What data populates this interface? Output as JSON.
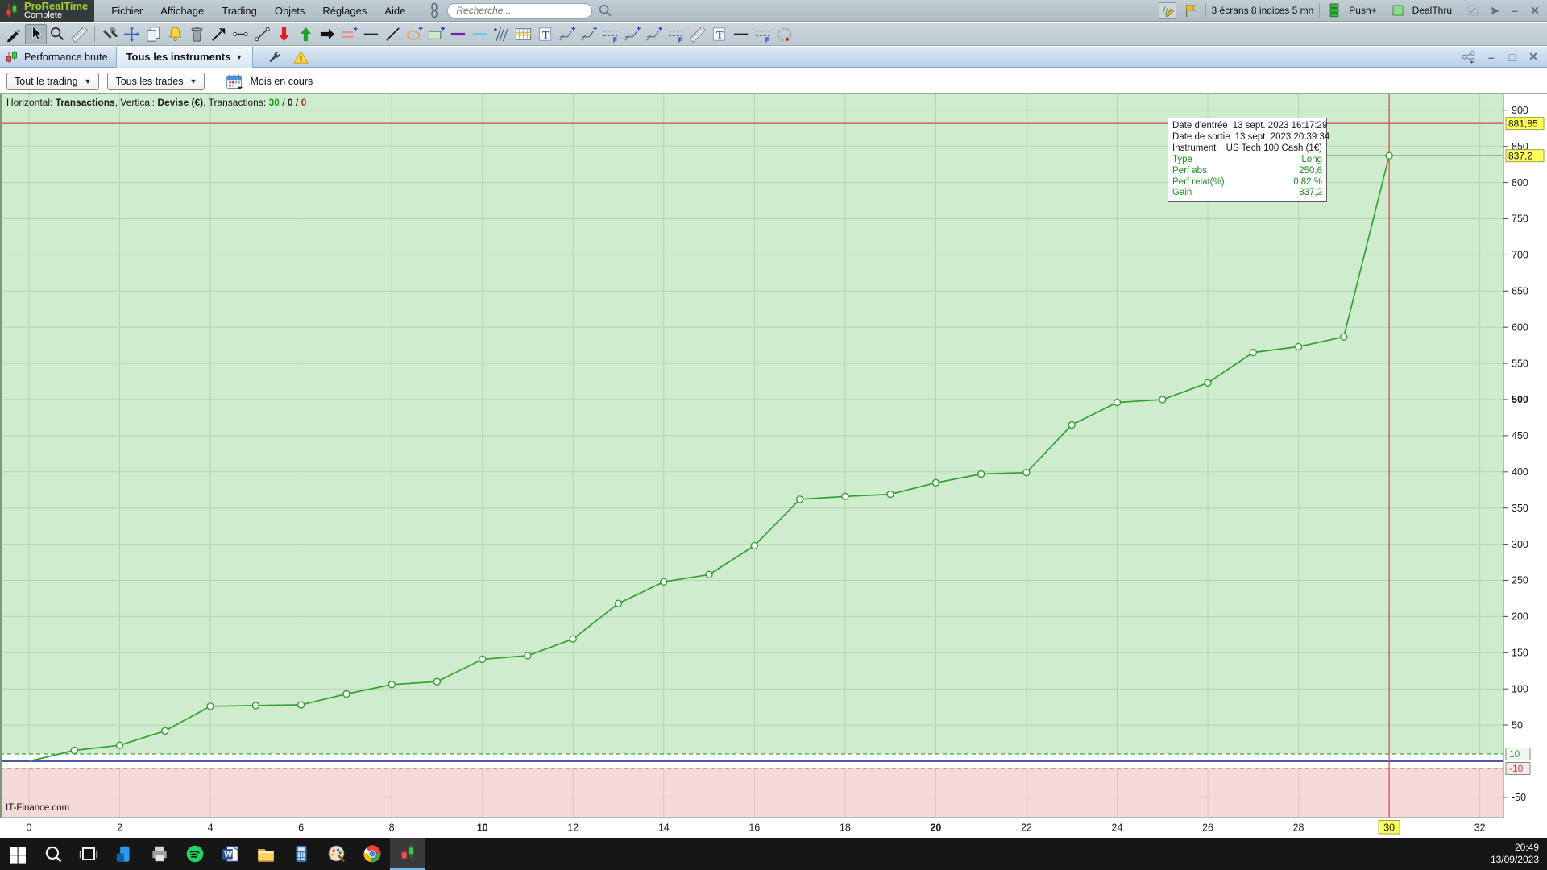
{
  "app": {
    "brand": "ProRealTime",
    "brand_sub": "Complete"
  },
  "menubar": {
    "menus": [
      "Fichier",
      "Affichage",
      "Trading",
      "Objets",
      "Réglages",
      "Aide"
    ],
    "search_placeholder": "Recherche ...",
    "right": {
      "screens_label": "3 écrans 8 indices 5 mn",
      "push_label": "Push+",
      "dealthru_label": "DealThru"
    }
  },
  "toolbar": {
    "tools": [
      "pencil",
      "cursor",
      "zoom",
      "ruler",
      "separator",
      "tools",
      "move",
      "duplicate",
      "alert-bell",
      "trash",
      "trend-arrow",
      "h-segment",
      "segment",
      "sell-arrow",
      "buy-arrow",
      "continue-arrow",
      "parallel-lines",
      "horizontal-line",
      "oblique-line",
      "ellipse",
      "rect-shape",
      "thick-line-purple",
      "line-cyan",
      "pitchfork",
      "fibo-grid",
      "textbox",
      "channel",
      "channel",
      "dashed-levels",
      "channel",
      "channel",
      "dashed-levels",
      "ruler",
      "textbox",
      "horizontal-line",
      "dashed-levels",
      "percent-wheel"
    ],
    "active_tool": "cursor"
  },
  "tabbar": {
    "window_title": "Performance brute",
    "active_tab": "Tous les instruments"
  },
  "filterbar": {
    "trading_filter": "Tout le trading",
    "trades_filter": "Tous les trades",
    "period_label": "Mois en cours"
  },
  "chart_header": {
    "h_label": "Horizontal: ",
    "h_value": "Transactions",
    "v_label": ", Vertical: ",
    "v_value": "Devise (€)",
    "t_label": ", Transactions: ",
    "count_win": "30",
    "count_mid": "0",
    "count_loss": "0",
    "slash": " / "
  },
  "chart_data": {
    "type": "line",
    "title": "Performance brute - Tous les instruments",
    "xlabel": "Transactions",
    "ylabel": "Devise (€)",
    "x": [
      0,
      1,
      2,
      3,
      4,
      5,
      6,
      7,
      8,
      9,
      10,
      11,
      12,
      13,
      14,
      15,
      16,
      17,
      18,
      19,
      20,
      21,
      22,
      23,
      24,
      25,
      26,
      27,
      28,
      29,
      30
    ],
    "values": [
      0,
      15,
      22,
      42,
      76,
      77,
      78,
      93,
      106,
      110,
      141,
      146,
      169,
      218,
      248,
      258,
      298,
      362,
      366,
      369,
      385,
      397,
      399,
      465,
      496,
      500,
      523,
      565,
      573,
      586.6,
      837.2
    ],
    "x_ticks": [
      0,
      2,
      4,
      6,
      8,
      10,
      12,
      14,
      16,
      18,
      20,
      22,
      24,
      26,
      28,
      30,
      32
    ],
    "bold_x_ticks": [
      10,
      20
    ],
    "highlighted_x_tick": {
      "label": "30",
      "value": 30
    },
    "y_ticks": [
      900,
      850,
      800,
      750,
      700,
      650,
      600,
      550,
      500,
      450,
      400,
      350,
      300,
      250,
      200,
      150,
      100,
      50,
      -50
    ],
    "bold_y_ticks": [
      500
    ],
    "ylim": [
      -77,
      920
    ],
    "xlim": [
      -0.6,
      33.2
    ],
    "grid": true,
    "legend": "none",
    "bands": {
      "positive_above": 10,
      "negative_below": -10
    },
    "lines": {
      "zero_value": 0,
      "upper_dashed": 10,
      "lower_dashed": -10,
      "max_red_line": 881.85,
      "current_transaction_line": 30,
      "last_value_leader": 837.2
    },
    "highlighted_y_labels": [
      {
        "label": "881,85",
        "value": 881.85
      },
      {
        "label": "837,2",
        "value": 837.2
      }
    ],
    "boxed_y_labels": [
      {
        "label": "10",
        "value": 10,
        "color": "green"
      },
      {
        "label": "-10",
        "value": -10,
        "color": "red"
      }
    ],
    "colors": {
      "curve": "#33a033",
      "positive_bg": "#cfeccf",
      "negative_bg": "#f5dada",
      "grid_green": "#b2d4b2",
      "grid_pink": "#e0c4c4",
      "red_line": "#e04040",
      "zero_line": "#1a1a8c",
      "highlight_yellow": "#ffff55"
    }
  },
  "tooltip": {
    "rows": [
      {
        "label": "Date d'entrée",
        "value": "13 sept. 2023 16:17:29",
        "tone": "dark"
      },
      {
        "label": "Date de sortie",
        "value": "13 sept. 2023 20:39:34",
        "tone": "dark"
      },
      {
        "label": "Instrument",
        "value": "US Tech 100 Cash (1€)",
        "tone": "dark"
      },
      {
        "label": "Type",
        "value": "Long",
        "tone": "green"
      },
      {
        "label": "Perf abs",
        "value": "250,6",
        "tone": "green"
      },
      {
        "label": "Perf relat(%)",
        "value": "0,82 %",
        "tone": "green"
      },
      {
        "label": "Gain",
        "value": "837,2",
        "tone": "green"
      }
    ]
  },
  "footer_note": "IT-Finance.com",
  "taskbar": {
    "items": [
      "windows-start",
      "taskbar-search",
      "task-view",
      "your-phone",
      "printer",
      "spotify",
      "word",
      "file-explorer",
      "calculator",
      "paint",
      "chrome",
      "prorealtime-active"
    ],
    "active_item": "prorealtime-active",
    "time": "20:49",
    "date": "13/09/2023"
  }
}
